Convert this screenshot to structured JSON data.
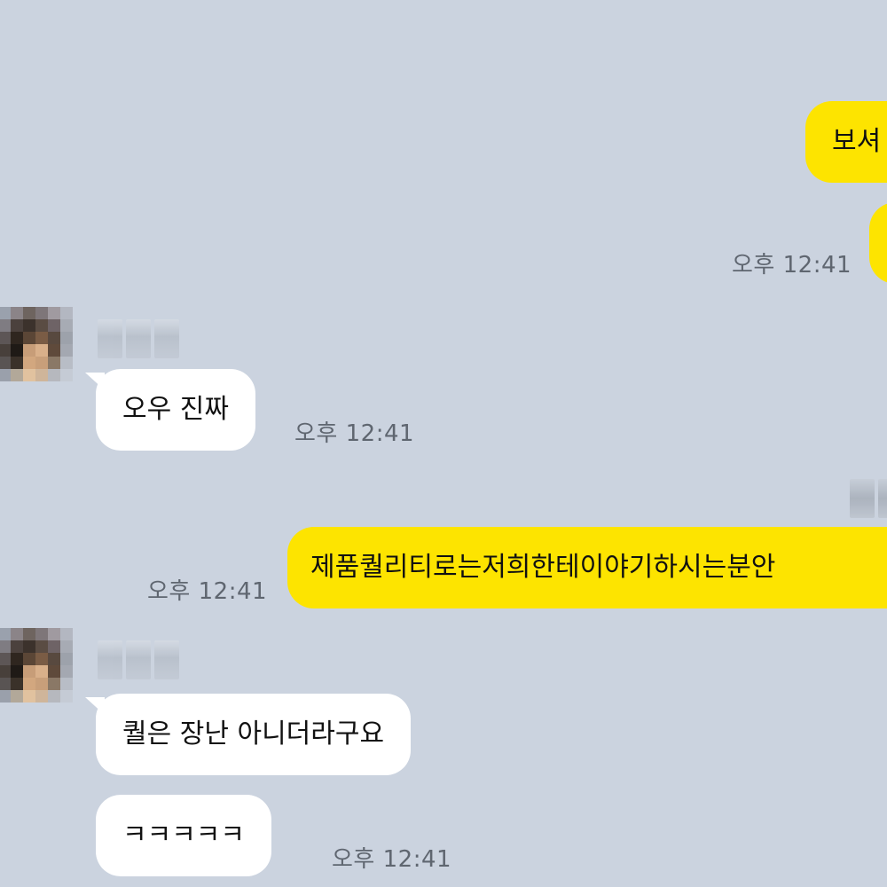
{
  "messages": {
    "mine_1": {
      "text": "보셔"
    },
    "mine_2": {
      "text": "",
      "time": "오후 12:41"
    },
    "theirs_1": {
      "text": "오우 진짜",
      "time": "오후 12:41"
    },
    "mine_3": {
      "text": "제품퀄리티로는저희한테이야기하시는분안",
      "time": "오후 12:41"
    },
    "theirs_2": {
      "text": "퀄은 장난 아니더라구요"
    },
    "theirs_3": {
      "text": "ㅋㅋㅋㅋㅋ",
      "time": "오후 12:41"
    }
  },
  "colors": {
    "background": "#cbd3df",
    "my_bubble": "#fde400",
    "their_bubble": "#ffffff",
    "time_text": "#5f6670"
  }
}
